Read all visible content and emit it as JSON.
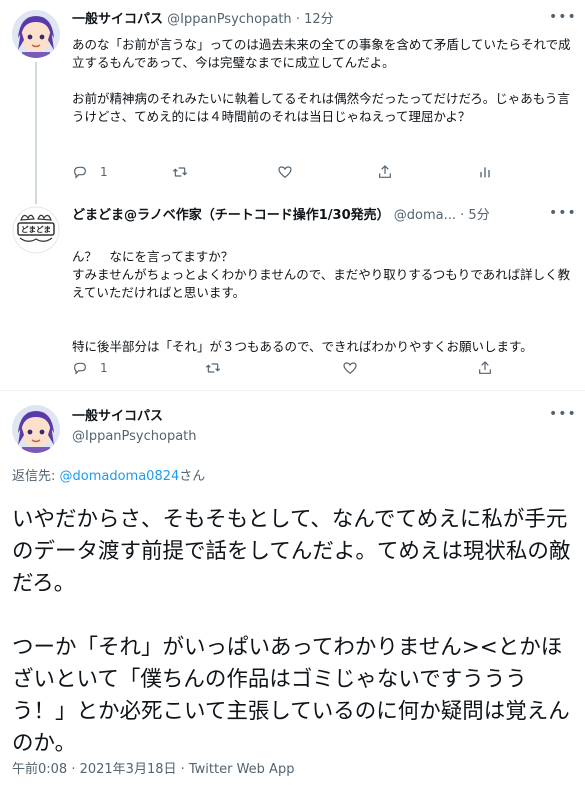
{
  "tweets": [
    {
      "name": "一般サイコパス",
      "handle": "@IppanPsychopath",
      "separator": "·",
      "time": "12分",
      "paragraphs": [
        "あのな「お前が言うな」ってのは過去未来の全ての事象を含めて矛盾していたらそれで成立するもんであって、今は完璧なまでに成立してんだよ。",
        "お前が精神病のそれみたいに執着してるそれは偶然今だったってだけだろ。じゃあもう言うけどさ、てめえ的には４時間前のそれは当日じゃねえって理屈かよ？"
      ],
      "reply_count": "1"
    },
    {
      "name": "どまどま@ラノベ作家（チートコード操作1/30発売）",
      "handle": "@doma...",
      "separator": "·",
      "time": "5分",
      "avatar_text": "どまどま",
      "paragraphs": [
        "ん？　なにを言ってますか？\nすみませんがちょっとよくわかりませんので、まだやり取りするつもりであれば詳しく教えていただければと思います。",
        "特に後半部分は「それ」が３つもあるので、できればわかりやすくお願いします。"
      ],
      "reply_count": "1"
    }
  ],
  "main_tweet": {
    "name": "一般サイコパス",
    "handle": "@IppanPsychopath",
    "reply_label": "返信先: ",
    "reply_target": "@domadoma0824",
    "reply_suffix": "さん",
    "paragraphs": [
      "いやだからさ、そもそもとして、なんでてめえに私が手元のデータ渡す前提で話をしてんだよ。てめえは現状私の敵だろ。",
      "つーか「それ」がいっぱいあってわかりません><とかほざいといて「僕ちんの作品はゴミじゃないですうううう！」とか必死こいて主張しているのに何か疑問は覚えんのか。"
    ],
    "meta": "午前0:08 · 2021年3月18日 · Twitter Web App"
  },
  "colors": {
    "text": "#0f1419",
    "secondary": "#536471",
    "link": "#1d9bf0",
    "divider": "#eff3f4",
    "thread_line": "#cfd9de"
  },
  "icons": [
    "more-icon",
    "reply-icon",
    "retweet-icon",
    "like-icon",
    "share-icon",
    "analytics-icon"
  ]
}
